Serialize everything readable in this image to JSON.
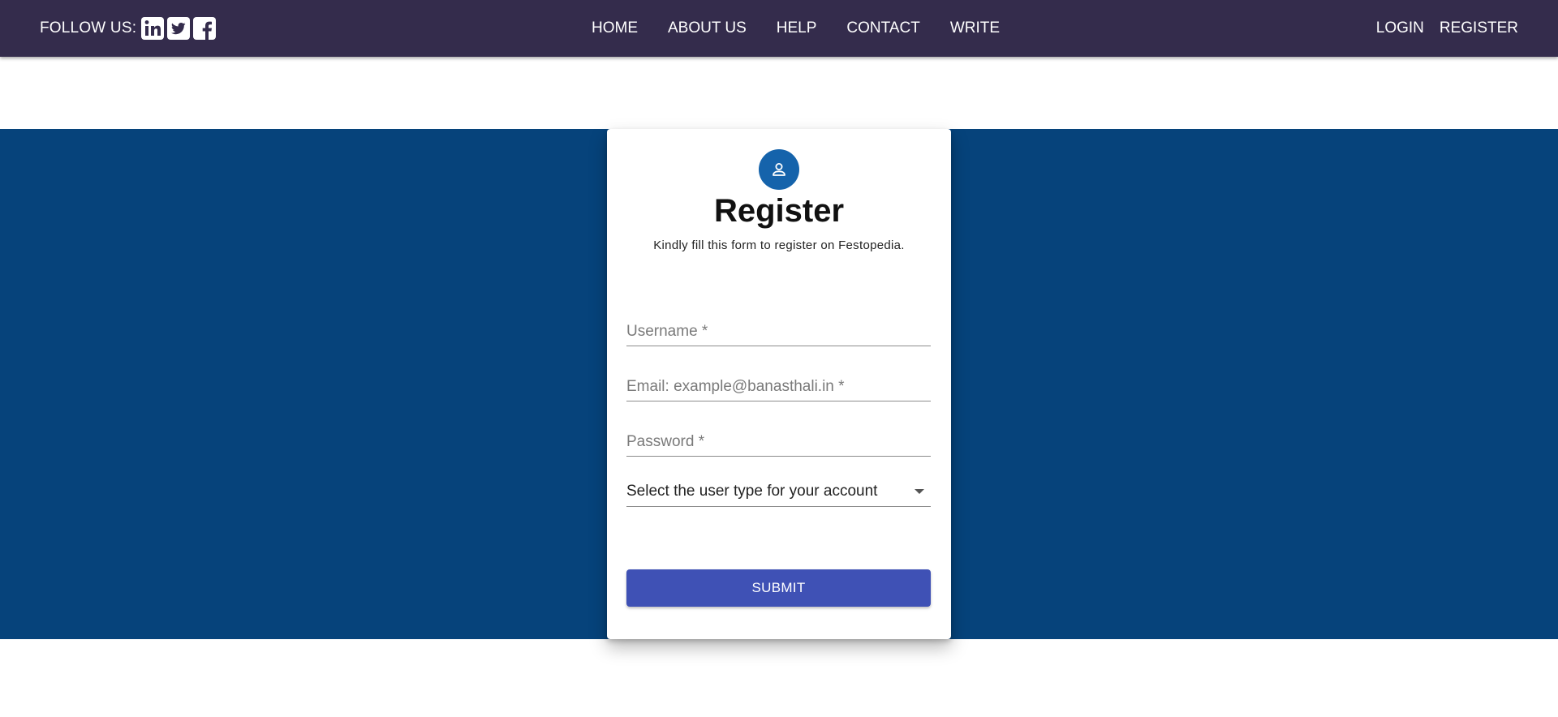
{
  "header": {
    "follow_label": "FOLLOW US:",
    "social_icons": [
      "linkedin-icon",
      "twitter-icon",
      "facebook-icon"
    ],
    "nav_links": [
      "HOME",
      "ABOUT US",
      "HELP",
      "CONTACT",
      "WRITE"
    ],
    "auth_links": [
      "LOGIN",
      "REGISTER"
    ]
  },
  "form": {
    "icon": "user-icon",
    "title": "Register",
    "subtitle": "Kindly fill this form to register on Festopedia.",
    "username_placeholder": "Username *",
    "email_placeholder": "Email: example@banasthali.in *",
    "password_placeholder": "Password *",
    "user_type_label": "Select the user type for your account",
    "submit_label": "SUBMIT"
  },
  "colors": {
    "navbar": "#342c4c",
    "band": "#06437b",
    "avatar": "#1563ab",
    "submit": "#3f51b5"
  }
}
